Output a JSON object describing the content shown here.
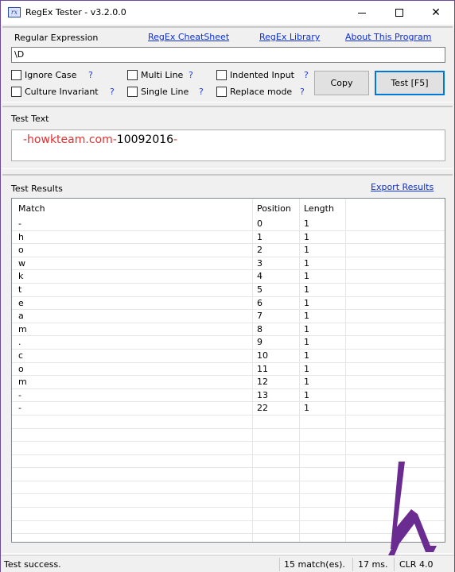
{
  "window": {
    "title": "RegEx Tester - v3.2.0.0",
    "icon_text": "rx",
    "controls": {
      "minimize": "minimize-icon",
      "maximize": "maximize-icon",
      "close": "✕"
    }
  },
  "regex_panel": {
    "label": "Regular Expression",
    "links": {
      "cheatsheet": "RegEx CheatSheet",
      "library": "RegEx Library",
      "about": "About This Program"
    },
    "value": "\\D",
    "options": [
      {
        "label": "Ignore Case",
        "checked": false
      },
      {
        "label": "Multi Line",
        "checked": false
      },
      {
        "label": "Indented Input",
        "checked": false
      },
      {
        "label": "Culture Invariant",
        "checked": false
      },
      {
        "label": "Single Line",
        "checked": false
      },
      {
        "label": "Replace mode",
        "checked": false
      }
    ],
    "help": "?",
    "copy_label": "Copy",
    "test_label": "Test [F5]"
  },
  "test_text": {
    "label": "Test Text",
    "segments": [
      {
        "text": "-howkteam.com-",
        "highlight": true
      },
      {
        "text": "10092016",
        "highlight": false
      },
      {
        "text": "-",
        "highlight": true
      }
    ]
  },
  "results": {
    "label": "Test Results",
    "export_label": "Export Results",
    "columns": [
      "Match",
      "Position",
      "Length"
    ],
    "rows": [
      [
        "-",
        "0",
        "1"
      ],
      [
        "h",
        "1",
        "1"
      ],
      [
        "o",
        "2",
        "1"
      ],
      [
        "w",
        "3",
        "1"
      ],
      [
        "k",
        "4",
        "1"
      ],
      [
        "t",
        "5",
        "1"
      ],
      [
        "e",
        "6",
        "1"
      ],
      [
        "a",
        "7",
        "1"
      ],
      [
        "m",
        "8",
        "1"
      ],
      [
        ".",
        "9",
        "1"
      ],
      [
        "c",
        "10",
        "1"
      ],
      [
        "o",
        "11",
        "1"
      ],
      [
        "m",
        "12",
        "1"
      ],
      [
        "-",
        "13",
        "1"
      ],
      [
        "-",
        "22",
        "1"
      ]
    ],
    "empty_rows": 10
  },
  "status": {
    "message": "Test success.",
    "matches": "15 match(es).",
    "time": "17 ms.",
    "clr": "CLR 4.0"
  },
  "colors": {
    "accent": "#0078d7",
    "link": "#0d2fd6",
    "highlight": "#e03030",
    "logo": "#6a2c91",
    "border": "#6a4a99"
  },
  "logo_icon": "howkteam-logo-icon"
}
